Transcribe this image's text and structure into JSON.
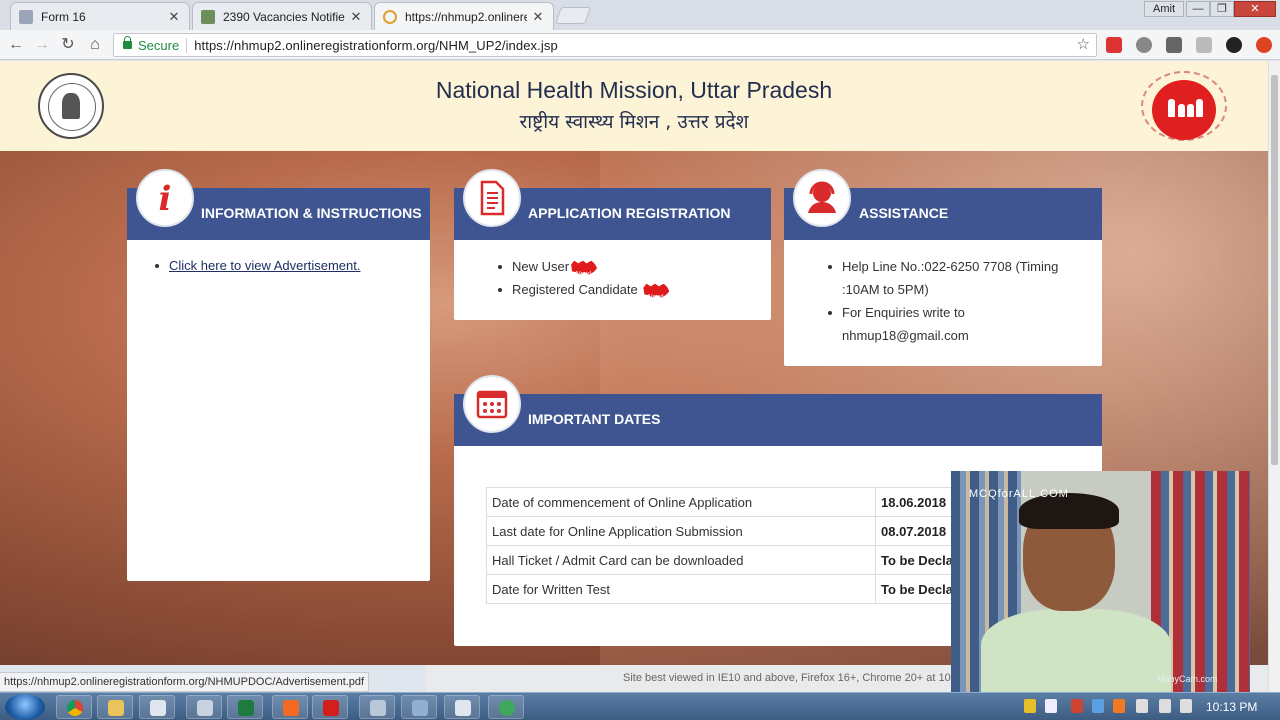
{
  "browser": {
    "tabs": [
      {
        "label": "Form 16",
        "close": "✕"
      },
      {
        "label": "2390 Vacancies Notified",
        "close": "✕"
      },
      {
        "label": "https://nhmup2.onlinere",
        "close": "✕"
      }
    ],
    "window_user": "Amit",
    "window_controls": {
      "minimize": "—",
      "maximize": "❐",
      "close": "✕"
    },
    "secure_label": "Secure",
    "url": "https://nhmup2.onlineregistrationform.org/NHM_UP2/index.jsp",
    "status_url": "https://nhmup2.onlineregistrationform.org/NHMUPDOC/Advertisement.pdf"
  },
  "header": {
    "title": "National Health Mission, Uttar Pradesh",
    "subtitle": "राष्ट्रीय स्वास्थ्य मिशन , उत्तर प्रदेश"
  },
  "info_card": {
    "title": "INFORMATION & INSTRUCTIONS",
    "badge_glyph": "i",
    "link": "Click here to view Advertisement."
  },
  "registration_card": {
    "title": "APPLICATION REGISTRATION",
    "items": [
      "New User",
      "Registered Candidate"
    ],
    "new_tag": "New!"
  },
  "assistance_card": {
    "title": "ASSISTANCE",
    "items": [
      "Help Line No.:022-6250 7708 (Timing :10AM to 5PM)",
      "For Enquiries write to nhmup18@gmail.com"
    ]
  },
  "dates_card": {
    "title": "IMPORTANT DATES",
    "rows": [
      {
        "label": "Date of commencement of Online Application",
        "value": "18.06.2018"
      },
      {
        "label": "Last date for Online Application Submission",
        "value": "08.07.2018"
      },
      {
        "label": "Hall Ticket / Admit Card can be downloaded",
        "value": "To be Decla"
      },
      {
        "label": "Date for Written Test",
        "value": "To be Decla"
      }
    ]
  },
  "footer": {
    "text": "Site best viewed in IE10 and above, Firefox 16+, Chrome 20+ at 10"
  },
  "webcam": {
    "watermark": "MCQforALL.COM",
    "logo": "ManyCam.com"
  },
  "taskbar": {
    "clock": "10:13 PM"
  },
  "colors": {
    "header_bg": "#fdf3d7",
    "card_head": "#3e5591",
    "accent_red": "#e02020",
    "title_text": "#222f4f"
  },
  "icons": [
    "info-icon",
    "document-icon",
    "support-agent-icon",
    "calendar-icon",
    "lock-icon",
    "star-icon"
  ]
}
